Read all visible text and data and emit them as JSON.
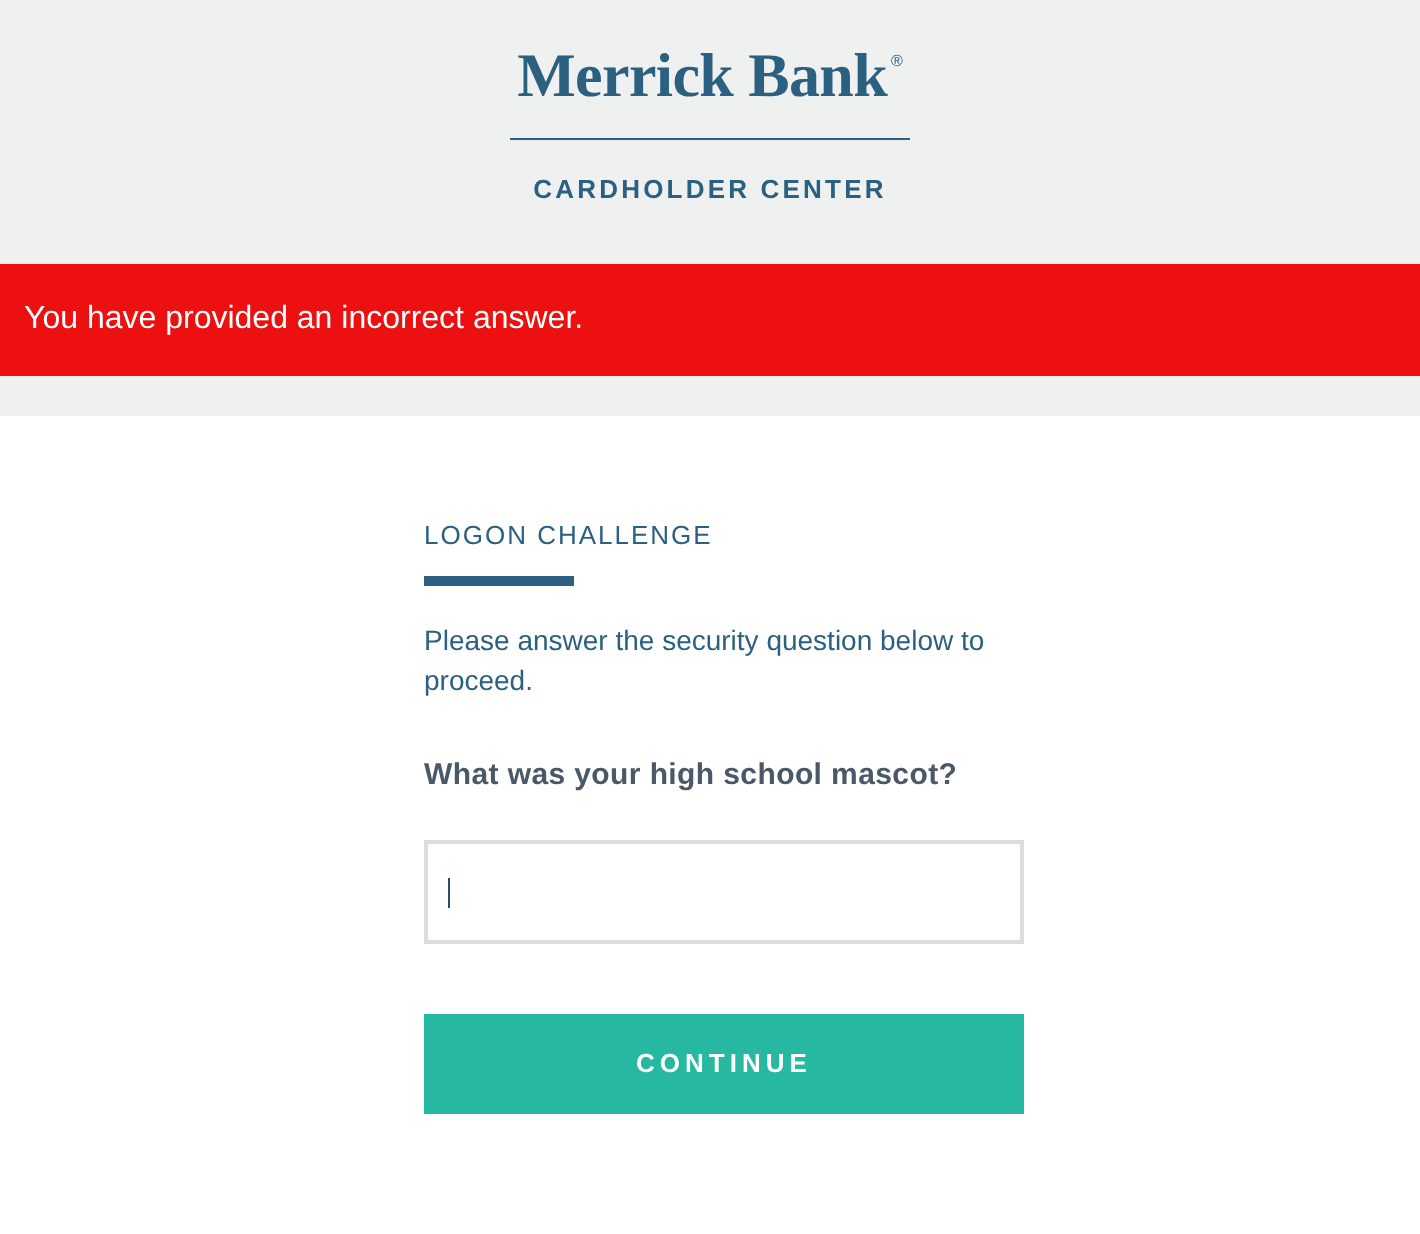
{
  "header": {
    "logo": {
      "name": "Merrick Bank",
      "mark": "®"
    },
    "subtitle": "CARDHOLDER CENTER"
  },
  "alert": {
    "kind": "error",
    "message": "You have provided an incorrect answer."
  },
  "challenge": {
    "title": "LOGON CHALLENGE",
    "instructions": "Please answer the security question below to proceed.",
    "question": "What was your high school mascot?",
    "answer": {
      "focused": true
    },
    "button": "CONTINUE"
  }
}
